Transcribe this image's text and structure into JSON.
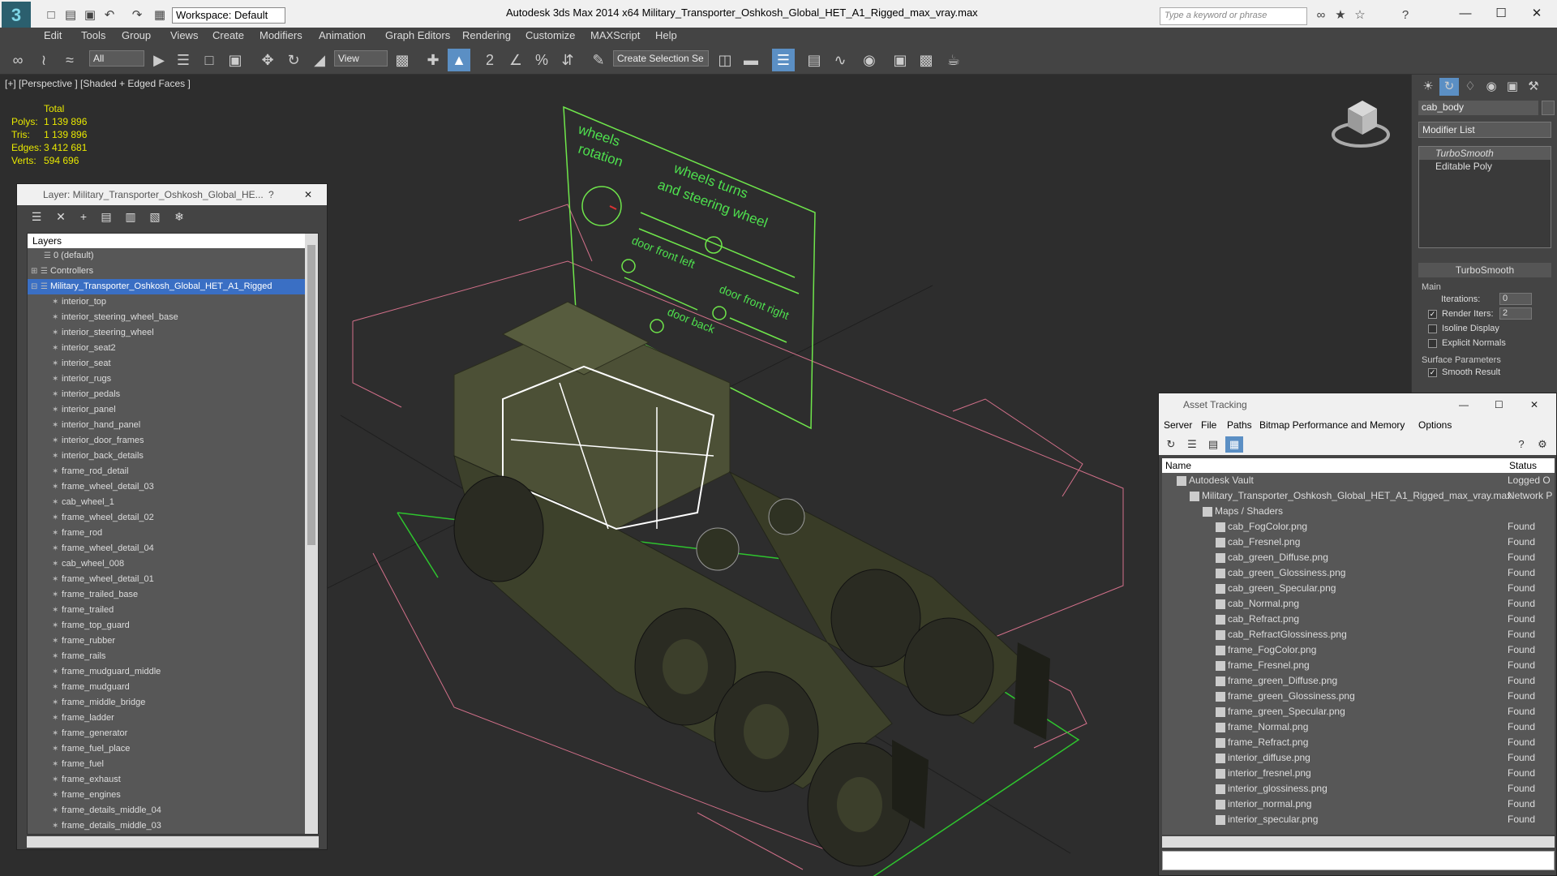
{
  "window": {
    "title": "Autodesk 3ds Max  2014 x64      Military_Transporter_Oshkosh_Global_HET_A1_Rigged_max_vray.max",
    "workspace": "Workspace: Default",
    "search_placeholder": "Type a keyword or phrase",
    "min": "—",
    "max": "☐",
    "close": "✕"
  },
  "menu": [
    "Edit",
    "Tools",
    "Group",
    "Views",
    "Create",
    "Modifiers",
    "Animation",
    "Graph Editors",
    "Rendering",
    "Customize",
    "MAXScript",
    "Help"
  ],
  "toolbar": {
    "filter": "All",
    "refcoord": "View",
    "selection_set": "Create Selection Se"
  },
  "viewport": {
    "label": "[+] [Perspective ] [Shaded + Edged Faces ]",
    "stats_header": "Total",
    "stats": [
      {
        "label": "Polys:",
        "value": "1 139 896"
      },
      {
        "label": "Tris:",
        "value": "1 139 896"
      },
      {
        "label": "Edges:",
        "value": "3 412 681"
      },
      {
        "label": "Verts:",
        "value": "594 696"
      }
    ],
    "rig_labels": {
      "wheels_rotation_1": "wheels",
      "wheels_rotation_2": "rotation",
      "turns_1": "wheels turns",
      "turns_2": "and steering wheel",
      "door_front_left": "door front left",
      "door_front_right": "door front right",
      "door_back": "door back"
    }
  },
  "command_panel": {
    "object_name": "cab_body",
    "modifier_list": "Modifier List",
    "stack": [
      "TurboSmooth",
      "Editable Poly"
    ],
    "rollout_title": "TurboSmooth",
    "main_group": "Main",
    "iterations_label": "Iterations:",
    "iterations_value": "0",
    "render_iters_label": "Render Iters:",
    "render_iters_value": "2",
    "isoline": "Isoline Display",
    "explicit_normals": "Explicit Normals",
    "surface_group": "Surface Parameters",
    "smooth_result": "Smooth Result"
  },
  "layer_window": {
    "title": "Layer: Military_Transporter_Oshkosh_Global_HE...",
    "help": "?",
    "close": "✕",
    "column": "Layers",
    "layers": [
      {
        "name": "0 (default)",
        "level": 1,
        "selected": false
      },
      {
        "name": "Controllers",
        "level": 1,
        "selected": false
      },
      {
        "name": "Military_Transporter_Oshkosh_Global_HET_A1_Rigged",
        "level": 1,
        "selected": true
      }
    ],
    "objects": [
      "interior_top",
      "interior_steering_wheel_base",
      "interior_steering_wheel",
      "interior_seat2",
      "interior_seat",
      "interior_rugs",
      "interior_pedals",
      "interior_panel",
      "interior_hand_panel",
      "interior_door_frames",
      "interior_back_details",
      "frame_rod_detail",
      "frame_wheel_detail_03",
      "cab_wheel_1",
      "frame_wheel_detail_02",
      "frame_rod",
      "frame_wheel_detail_04",
      "cab_wheel_008",
      "frame_wheel_detail_01",
      "frame_trailed_base",
      "frame_trailed",
      "frame_top_guard",
      "frame_rubber",
      "frame_rails",
      "frame_mudguard_middle",
      "frame_mudguard",
      "frame_middle_bridge",
      "frame_ladder",
      "frame_generator",
      "frame_fuel_place",
      "frame_fuel",
      "frame_exhaust",
      "frame_engines",
      "frame_details_middle_04",
      "frame_details_middle_03"
    ]
  },
  "asset_window": {
    "title": "Asset Tracking",
    "menu": [
      "Server",
      "File",
      "Paths",
      "Bitmap Performance and Memory",
      "Options"
    ],
    "col_name": "Name",
    "col_status": "Status",
    "rows": [
      {
        "name": "Autodesk Vault",
        "status": "Logged O",
        "indent": 1
      },
      {
        "name": "Military_Transporter_Oshkosh_Global_HET_A1_Rigged_max_vray.max",
        "status": "Network P",
        "indent": 2
      },
      {
        "name": "Maps / Shaders",
        "status": "",
        "indent": 3
      },
      {
        "name": "cab_FogColor.png",
        "status": "Found",
        "indent": 4
      },
      {
        "name": "cab_Fresnel.png",
        "status": "Found",
        "indent": 4
      },
      {
        "name": "cab_green_Diffuse.png",
        "status": "Found",
        "indent": 4
      },
      {
        "name": "cab_green_Glossiness.png",
        "status": "Found",
        "indent": 4
      },
      {
        "name": "cab_green_Specular.png",
        "status": "Found",
        "indent": 4
      },
      {
        "name": "cab_Normal.png",
        "status": "Found",
        "indent": 4
      },
      {
        "name": "cab_Refract.png",
        "status": "Found",
        "indent": 4
      },
      {
        "name": "cab_RefractGlossiness.png",
        "status": "Found",
        "indent": 4
      },
      {
        "name": "frame_FogColor.png",
        "status": "Found",
        "indent": 4
      },
      {
        "name": "frame_Fresnel.png",
        "status": "Found",
        "indent": 4
      },
      {
        "name": "frame_green_Diffuse.png",
        "status": "Found",
        "indent": 4
      },
      {
        "name": "frame_green_Glossiness.png",
        "status": "Found",
        "indent": 4
      },
      {
        "name": "frame_green_Specular.png",
        "status": "Found",
        "indent": 4
      },
      {
        "name": "frame_Normal.png",
        "status": "Found",
        "indent": 4
      },
      {
        "name": "frame_Refract.png",
        "status": "Found",
        "indent": 4
      },
      {
        "name": "interior_diffuse.png",
        "status": "Found",
        "indent": 4
      },
      {
        "name": "interior_fresnel.png",
        "status": "Found",
        "indent": 4
      },
      {
        "name": "interior_glossiness.png",
        "status": "Found",
        "indent": 4
      },
      {
        "name": "interior_normal.png",
        "status": "Found",
        "indent": 4
      },
      {
        "name": "interior_specular.png",
        "status": "Found",
        "indent": 4
      }
    ]
  },
  "colors": {
    "accent": "#5b8fc4",
    "stats": "#e8e800",
    "rig_green": "#4ee04e",
    "selection": "#ffffff"
  }
}
